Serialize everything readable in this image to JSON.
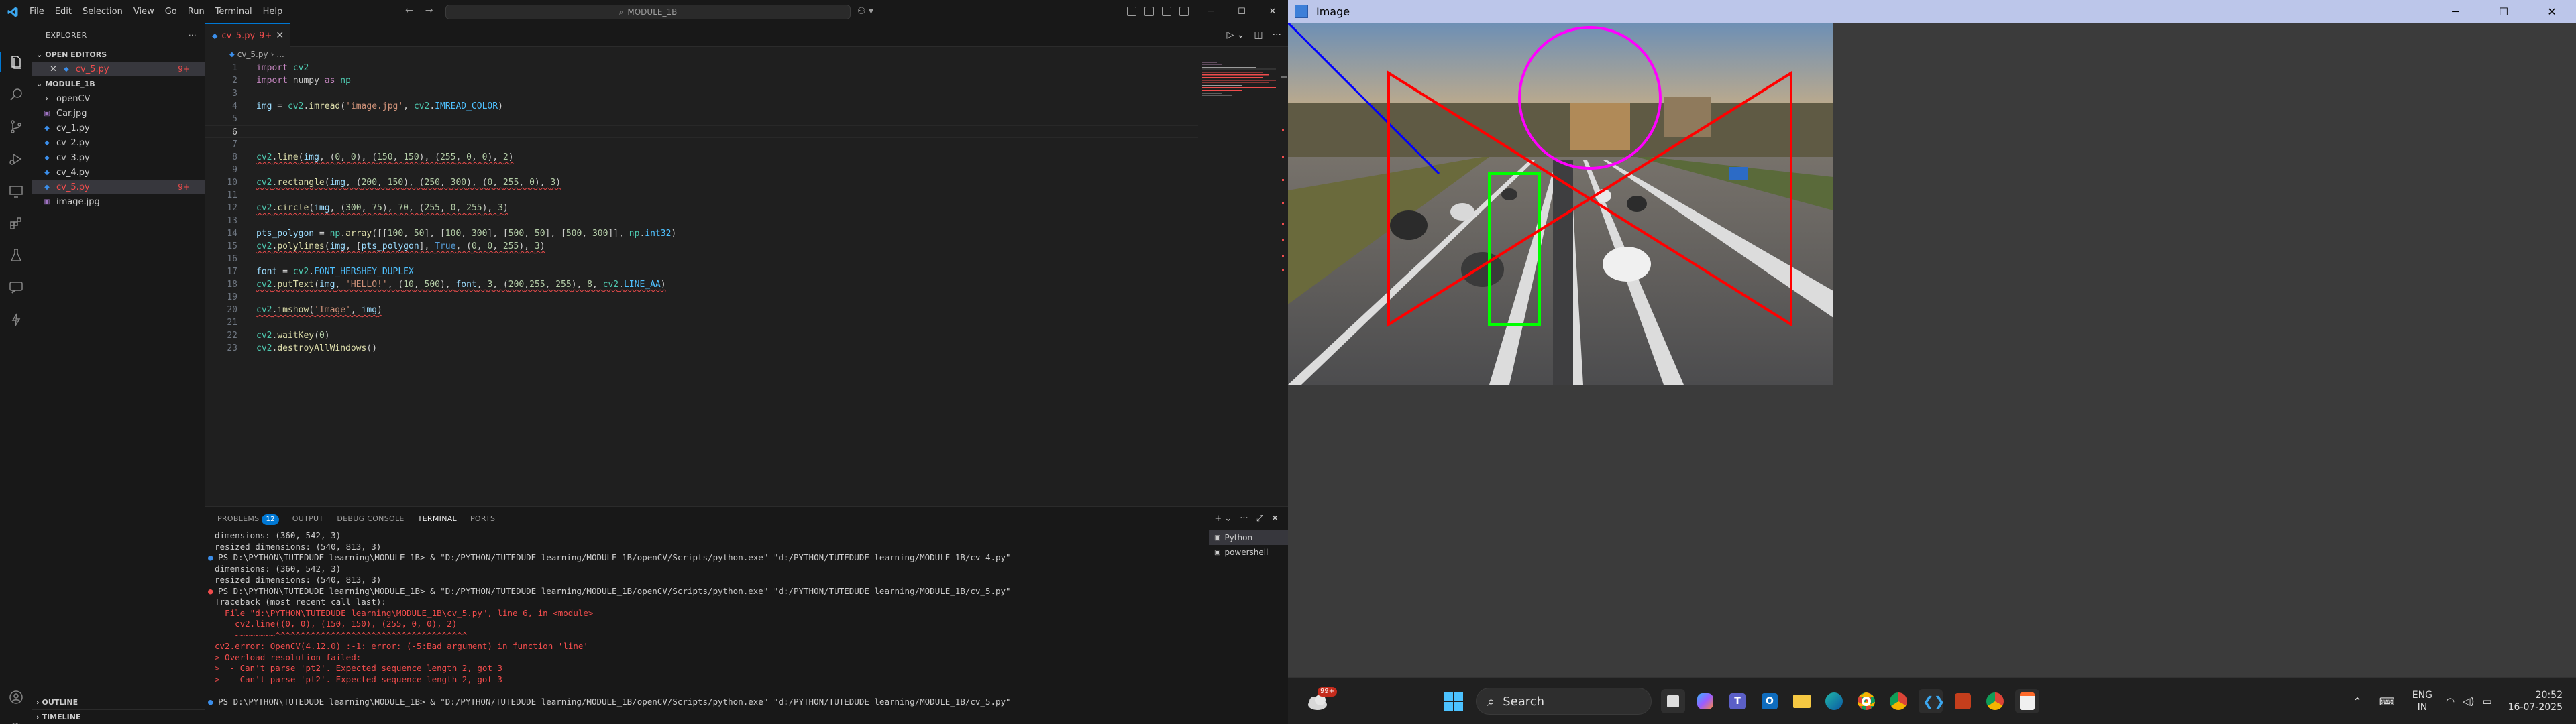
{
  "vscode": {
    "menu": [
      "File",
      "Edit",
      "Selection",
      "View",
      "Go",
      "Run",
      "Terminal",
      "Help"
    ],
    "search": "MODULE_1B",
    "explorer": {
      "title": "EXPLORER",
      "open_editors_label": "OPEN EDITORS",
      "open_file": "cv_5.py",
      "open_file_badge": "9+",
      "folder_label": "MODULE_1B",
      "items": [
        {
          "name": "openCV",
          "type": "folder"
        },
        {
          "name": "Car.jpg",
          "type": "image"
        },
        {
          "name": "cv_1.py",
          "type": "py"
        },
        {
          "name": "cv_2.py",
          "type": "py"
        },
        {
          "name": "cv_3.py",
          "type": "py"
        },
        {
          "name": "cv_4.py",
          "type": "py"
        },
        {
          "name": "cv_5.py",
          "type": "py",
          "badge": "9+"
        },
        {
          "name": "image.jpg",
          "type": "image"
        }
      ],
      "outline_label": "OUTLINE",
      "timeline_label": "TIMELINE"
    },
    "tab": {
      "label": "cv_5.py",
      "badge": "9+"
    },
    "breadcrumb": "cv_5.py",
    "code_lines": [
      {
        "n": "1",
        "text": "import cv2"
      },
      {
        "n": "2",
        "text": "import numpy as np"
      },
      {
        "n": "3",
        "text": ""
      },
      {
        "n": "4",
        "text": "img = cv2.imread('image.jpg', cv2.IMREAD_COLOR)"
      },
      {
        "n": "5",
        "text": ""
      },
      {
        "n": "6",
        "text": ""
      },
      {
        "n": "7",
        "text": ""
      },
      {
        "n": "8",
        "text": "cv2.line(img, (0, 0), (150, 150), (255, 0, 0), 2)"
      },
      {
        "n": "9",
        "text": ""
      },
      {
        "n": "10",
        "text": "cv2.rectangle(img, (200, 150), (250, 300), (0, 255, 0), 3)"
      },
      {
        "n": "11",
        "text": ""
      },
      {
        "n": "12",
        "text": "cv2.circle(img, (300, 75), 70, (255, 0, 255), 3)"
      },
      {
        "n": "13",
        "text": ""
      },
      {
        "n": "14",
        "text": "pts_polygon = np.array([[100, 50], [100, 300], [500, 50], [500, 300]], np.int32)"
      },
      {
        "n": "15",
        "text": "cv2.polylines(img, [pts_polygon], True, (0, 0, 255), 3)"
      },
      {
        "n": "16",
        "text": ""
      },
      {
        "n": "17",
        "text": "font = cv2.FONT_HERSHEY_DUPLEX"
      },
      {
        "n": "18",
        "text": "cv2.putText(img, 'HELLO!', (10, 500), font, 3, (200,255, 255), 8, cv2.LINE_AA)"
      },
      {
        "n": "19",
        "text": ""
      },
      {
        "n": "20",
        "text": "cv2.imshow('Image', img)"
      },
      {
        "n": "21",
        "text": ""
      },
      {
        "n": "22",
        "text": "cv2.waitKey(0)"
      },
      {
        "n": "23",
        "text": "cv2.destroyAllWindows()"
      }
    ],
    "panel": {
      "tabs": [
        "PROBLEMS",
        "OUTPUT",
        "DEBUG CONSOLE",
        "TERMINAL",
        "PORTS"
      ],
      "problems_count": "12",
      "terminal_lines": [
        "dimensions: (360, 542, 3)",
        "resized dimensions: (540, 813, 3)",
        "PS D:\\PYTHON\\TUTEDUDE learning\\MODULE_1B> & \"D:/PYTHON/TUTEDUDE learning/MODULE_1B/openCV/Scripts/python.exe\" \"d:/PYTHON/TUTEDUDE learning/MODULE_1B/cv_4.py\"",
        "dimensions: (360, 542, 3)",
        "resized dimensions: (540, 813, 3)",
        "PS D:\\PYTHON\\TUTEDUDE learning\\MODULE_1B> & \"D:/PYTHON/TUTEDUDE learning/MODULE_1B/openCV/Scripts/python.exe\" \"d:/PYTHON/TUTEDUDE learning/MODULE_1B/cv_5.py\"",
        "Traceback (most recent call last):",
        "  File \"d:\\PYTHON\\TUTEDUDE learning\\MODULE_1B\\cv_5.py\", line 6, in <module>",
        "    cv2.line((0, 0), (150, 150), (255, 0, 0), 2)",
        "    ~~~~~~~~^^^^^^^^^^^^^^^^^^^^^^^^^^^^^^^^^^^^^^",
        "cv2.error: OpenCV(4.12.0) :-1: error: (-5:Bad argument) in function 'line'",
        "> Overload resolution failed:",
        ">  - Can't parse 'pt2'. Expected sequence length 2, got 3",
        ">  - Can't parse 'pt2'. Expected sequence length 2, got 3",
        "",
        "PS D:\\PYTHON\\TUTEDUDE learning\\MODULE_1B> & \"D:/PYTHON/TUTEDUDE learning/MODULE_1B/openCV/Scripts/python.exe\" \"d:/PYTHON/TUTEDUDE learning/MODULE_1B/cv_5.py\""
      ],
      "terminal_list": [
        "Python",
        "powershell"
      ]
    }
  },
  "image_window": {
    "title": "Image"
  },
  "taskbar": {
    "weather_badge": "99+",
    "search_placeholder": "Search",
    "lang_top": "ENG",
    "lang_bottom": "IN",
    "time": "20:52",
    "date": "16-07-2025"
  },
  "colors": {
    "accent": "#0078d4",
    "error": "#f14c4c",
    "image_title_bar": "#bcc6ea"
  }
}
